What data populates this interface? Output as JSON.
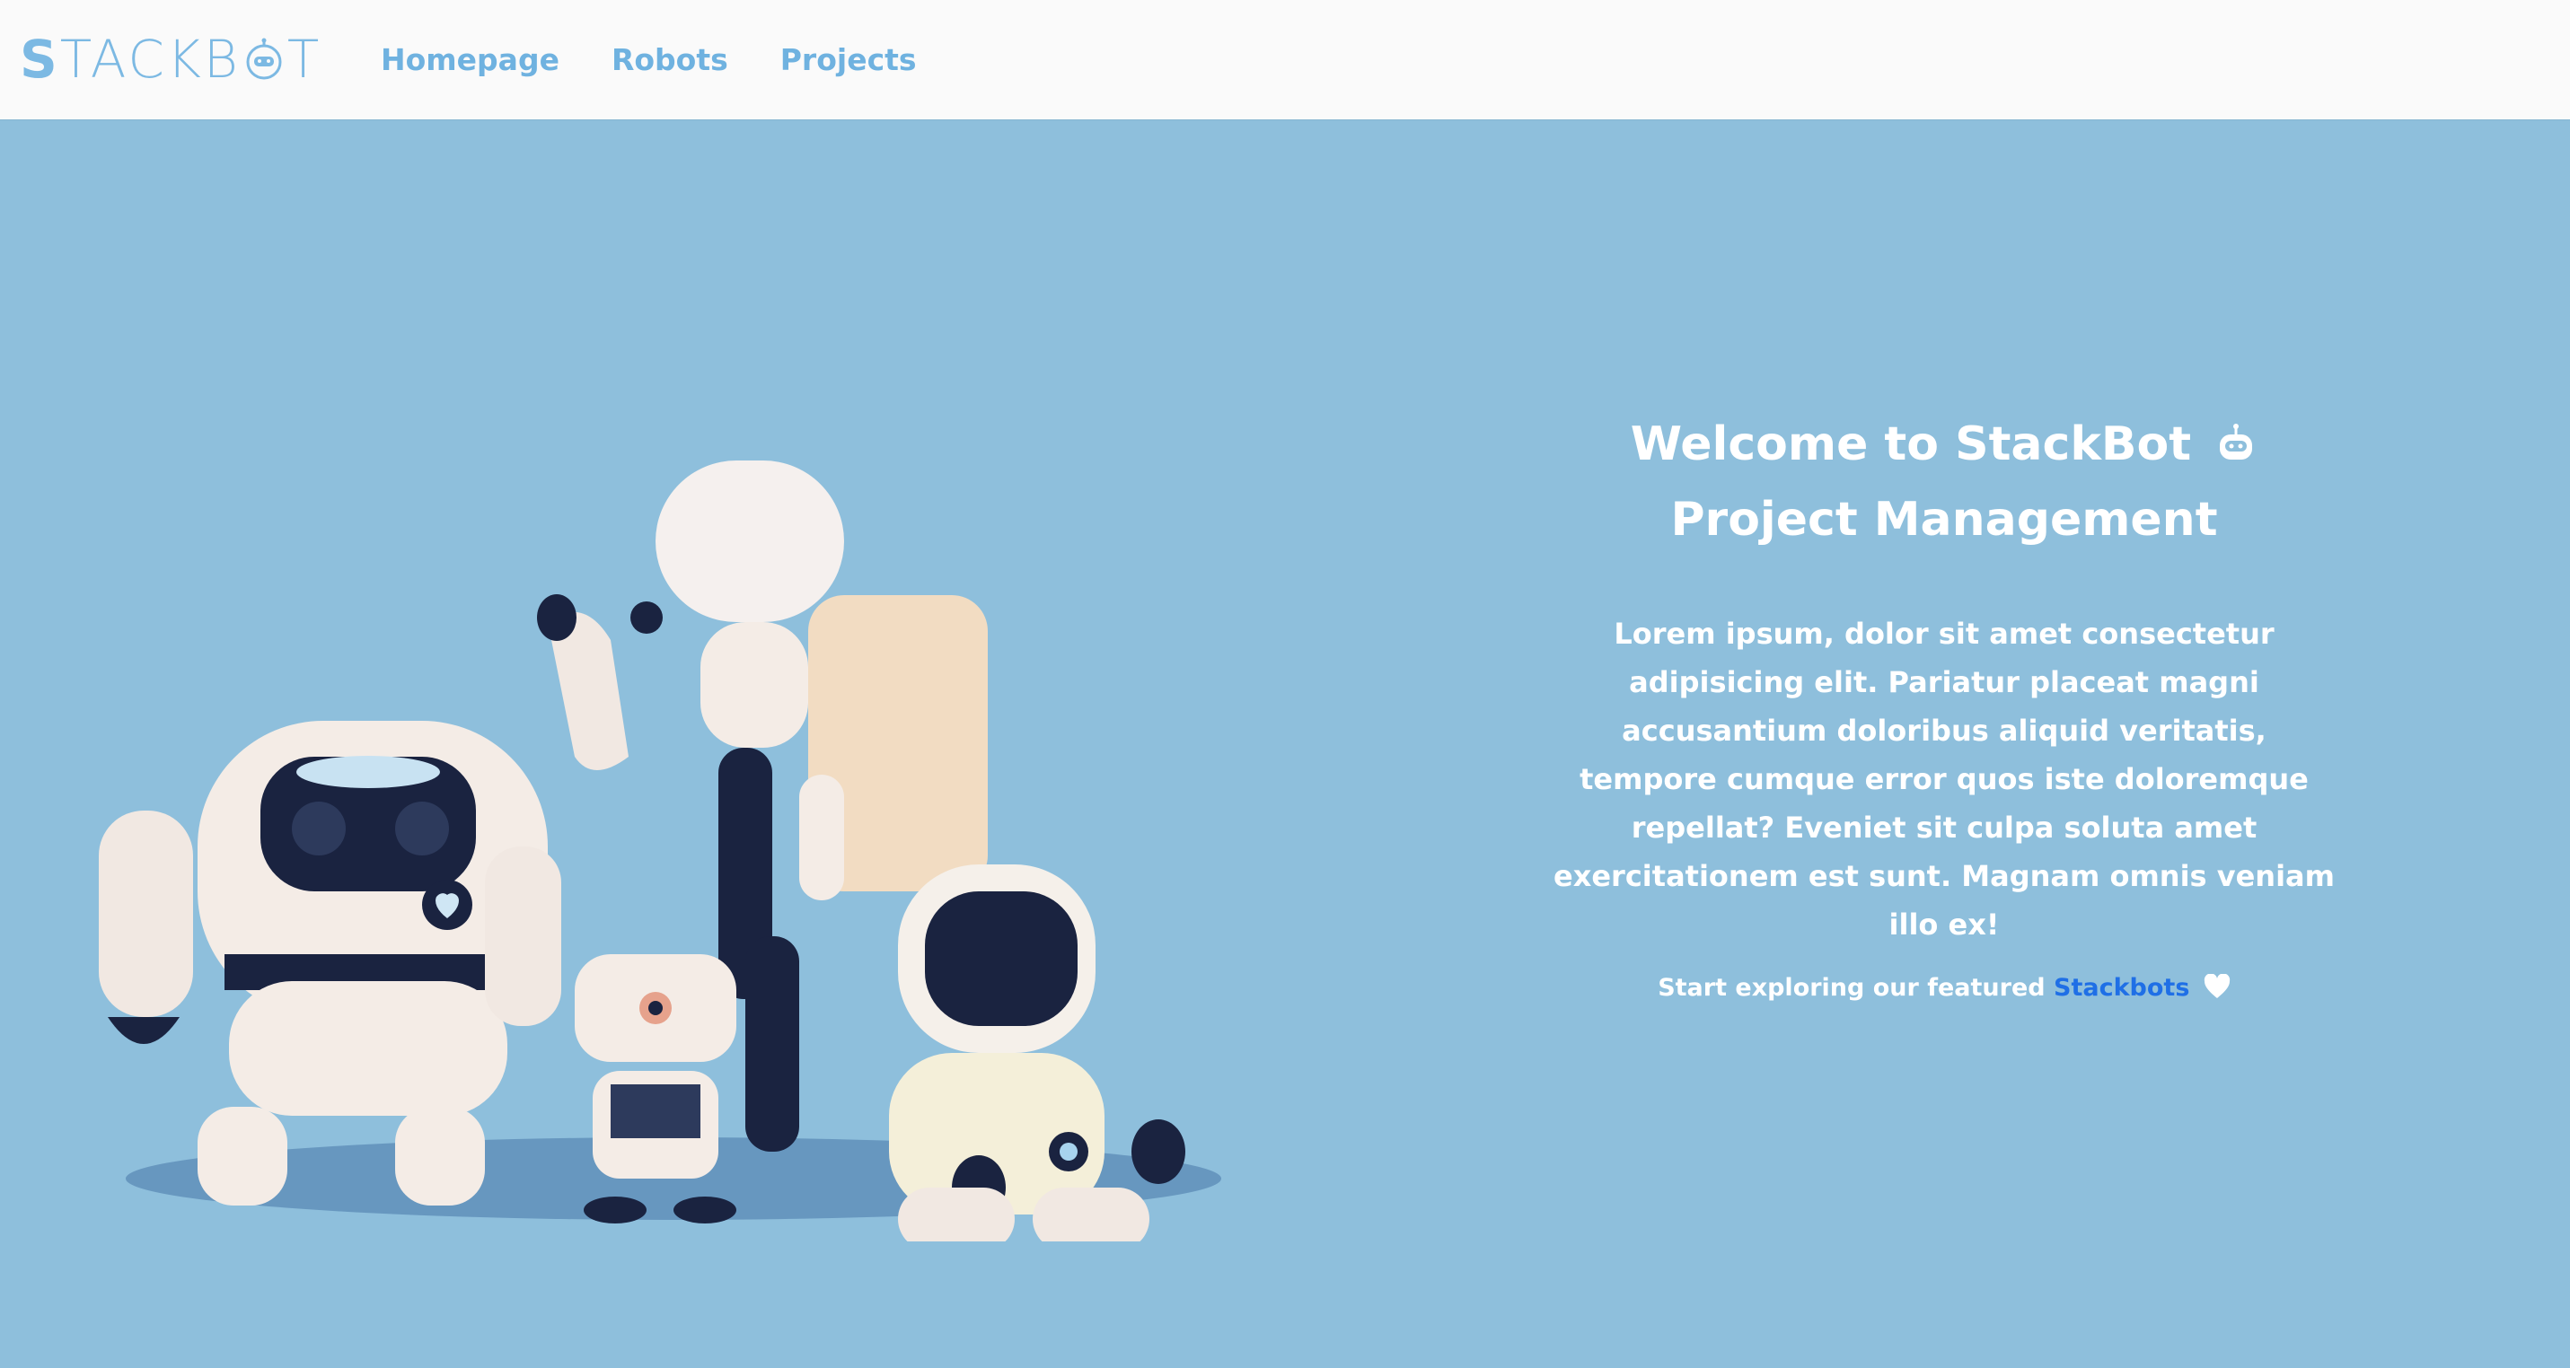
{
  "brand": {
    "name": "STACKBOT",
    "color": "#7cb9e3"
  },
  "nav": {
    "links": [
      {
        "label": "Homepage"
      },
      {
        "label": "Robots"
      },
      {
        "label": "Projects"
      }
    ]
  },
  "hero": {
    "title_line1": "Welcome to StackBot",
    "title_line2": "Project Management",
    "title_icon": "robot-face-icon",
    "description": "Lorem ipsum, dolor sit amet consectetur adipisicing elit. Pariatur placeat magni accusantium doloribus aliquid veritatis, tempore cumque error quos iste doloremque repellat? Eveniet sit culpa soluta amet exercitationem est sunt. Magnam omnis veniam illo ex!",
    "cta_prefix": "Start exploring our featured",
    "cta_link": "Stackbots",
    "cta_icon": "heart-icon"
  },
  "colors": {
    "background": "#8ebfdc",
    "navbar": "#fafafa",
    "link": "#1f6fe6",
    "nav_link": "#6fb2e0"
  }
}
